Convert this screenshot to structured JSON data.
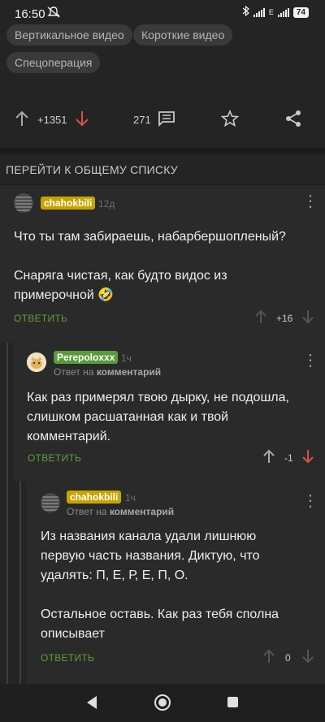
{
  "status_bar": {
    "time": "16:50",
    "mute_icon": "mute-icon",
    "network": "E",
    "battery": "74"
  },
  "tags": [
    "Вертикальное видео",
    "Короткие видео",
    "Спецоперация"
  ],
  "post_actions": {
    "rating": "+1351",
    "comments": "271"
  },
  "goto_list": "ПЕРЕЙТИ К ОБЩЕМУ СПИСКУ",
  "comments": [
    {
      "user": "chahokbili",
      "time": "12д",
      "reply_prefix": "",
      "reply_target": "",
      "text1": "Что ты там забираешь, набарбершопленый?",
      "text2": "Снаряга чистая, как будто видос из",
      "text3": "примерочной 🤣",
      "reply_label": "ОТВЕТИТЬ",
      "rating": "+16"
    },
    {
      "user": "Perepoloxxx",
      "time": "1ч",
      "reply_prefix": "Ответ на",
      "reply_target": "комментарий",
      "text1": "Как раз примерял твою дырку, не подошла,",
      "text2": "слишком расшатанная как и твой",
      "text3": "комментарий.",
      "reply_label": "ОТВЕТИТЬ",
      "rating": "-1"
    },
    {
      "user": "chahokbili",
      "time": "1ч",
      "reply_prefix": "Ответ на",
      "reply_target": "комментарий",
      "text1": "Из названия канала удали лишнюю",
      "text2": "первую часть названия. Диктую, что",
      "text3": "удалять: П, Е, Р, Е, П, О.",
      "text4": "Остальное оставь. Как раз тебя сполна",
      "text5": "описывает",
      "reply_label": "ОТВЕТИТЬ",
      "rating": "0"
    }
  ],
  "colors": {
    "username_yellow": "#c7a500",
    "username_green": "#5a9a3b",
    "reply_green": "#5f9e3a",
    "downvote_red": "#d9533f"
  }
}
